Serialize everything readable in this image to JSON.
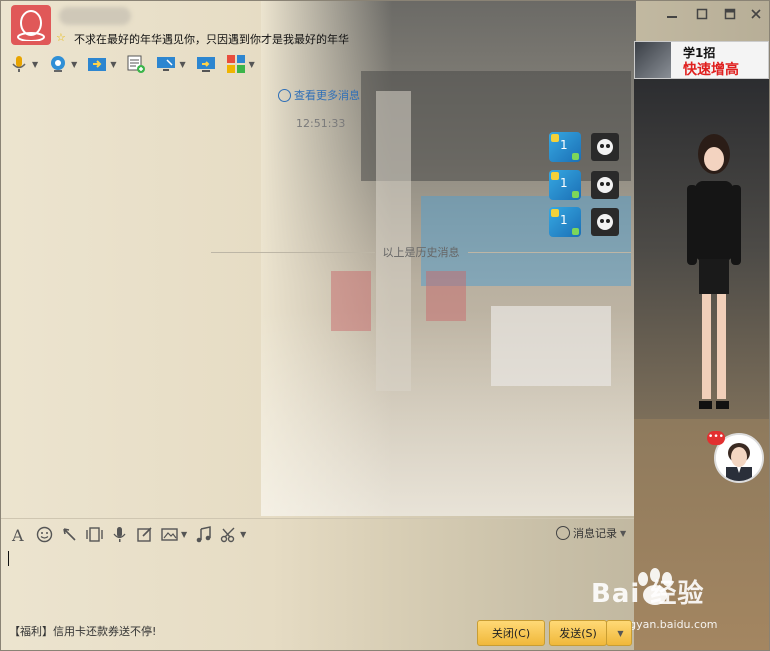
{
  "title_bar": {
    "signature": "不求在最好的年华遇见你，只因遇到你才是我最好的年华",
    "controls": [
      "minimize",
      "maximize",
      "close"
    ]
  },
  "toolbar": {
    "items": [
      {
        "name": "voice-call",
        "icon": "mic-icon"
      },
      {
        "name": "video-call",
        "icon": "camera-icon"
      },
      {
        "name": "send-file",
        "icon": "folder-send-icon"
      },
      {
        "name": "create-group",
        "icon": "chat-add-icon"
      },
      {
        "name": "remote-desktop",
        "icon": "monitor-icon"
      },
      {
        "name": "share-screen",
        "icon": "screen-share-icon"
      },
      {
        "name": "apps",
        "icon": "apps-grid-icon"
      }
    ]
  },
  "ad": {
    "line1": "学1招",
    "line2": "快速增高"
  },
  "messages": {
    "more_link": "查看更多消息",
    "timestamp": "12:51:33",
    "stickers": [
      {
        "value": "1"
      },
      {
        "value": "1"
      },
      {
        "value": "1"
      }
    ],
    "history_divider": "以上是历史消息"
  },
  "input_toolbar": {
    "items": [
      "font-icon",
      "emoji-icon",
      "poke-icon",
      "screenshot-icon",
      "voice-msg-icon",
      "doodle-icon",
      "image-icon",
      "music-icon",
      "scissors-icon"
    ],
    "history_label": "消息记录"
  },
  "footer": {
    "promo": "【福利】信用卡还款券送不停!",
    "close_label": "关闭(C)",
    "send_label": "发送(S)"
  },
  "watermark": {
    "text": "Bai 经验",
    "url": "jingyan.baidu.com"
  }
}
